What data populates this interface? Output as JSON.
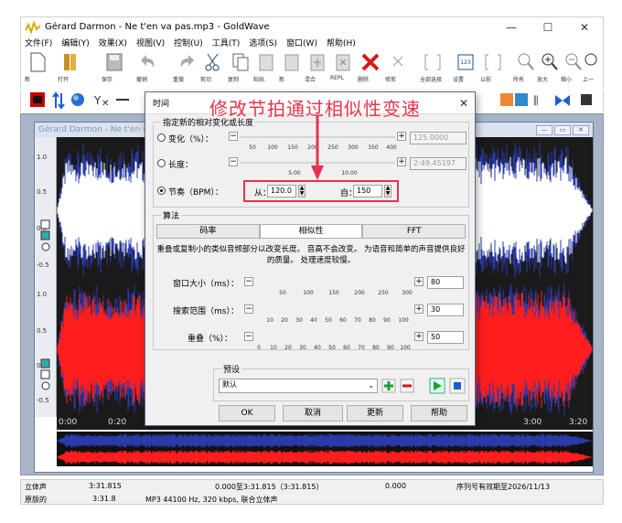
{
  "window": {
    "title": "Gérard Darmon - Ne t'en va pas.mp3 - GoldWave",
    "min": "—",
    "max": "☐",
    "close": "✕"
  },
  "menu": [
    "文件(F)",
    "编辑(Y)",
    "效果(X)",
    "视图(V)",
    "控制(U)",
    "工具(T)",
    "选项(S)",
    "窗口(W)",
    "帮助(H)"
  ],
  "toolbar": [
    {
      "label": "新"
    },
    {
      "label": "打开"
    },
    {
      "label": "保存"
    },
    {
      "label": "撤销"
    },
    {
      "label": "重做"
    },
    {
      "label": "剪切"
    },
    {
      "label": "复制"
    },
    {
      "label": "粘贴"
    },
    {
      "label": "新"
    },
    {
      "label": "混合"
    },
    {
      "label": "REPL"
    },
    {
      "label": "删除"
    },
    {
      "label": "修剪"
    },
    {
      "label": "全部选择"
    },
    {
      "label": "设置"
    },
    {
      "label": "以前"
    },
    {
      "label": "所有"
    },
    {
      "label": "放大"
    },
    {
      "label": "缩小"
    },
    {
      "label": "上一"
    }
  ],
  "doc": {
    "title": "Gérard Darmon - Ne t'en va pas"
  },
  "waveform": {
    "left_labels": [
      "1.0",
      "0.5",
      "0.0",
      "-0.5",
      "1.0",
      "0.5",
      "0.0",
      "-0.5"
    ],
    "timeline": [
      "0:00",
      "0:20",
      "3:00",
      "3:20"
    ],
    "colors": {
      "left": "#ffffff",
      "right": "#ff1e1e",
      "bg": "#1a1a1a",
      "overview_blue": "#2a3aa8"
    }
  },
  "dialog": {
    "title": "时间",
    "annotation": "修改节拍通过相似性变速",
    "group1_label": "指定新的相对变化或长度",
    "change_label": "变化（%）：",
    "change_value": "125.0000",
    "change_ticks": [
      "50",
      "100",
      "150",
      "200",
      "250",
      "300",
      "350",
      "400"
    ],
    "length_label": "长度：",
    "length_value": "2:49.45197",
    "length_ticks": [
      "5:00",
      "10:00"
    ],
    "tempo_label": "节奏（BPM）：",
    "from_label": "从：",
    "from_value": "120.0",
    "to_label": "自：",
    "to_value": "150",
    "algo_label": "算法",
    "tabs": [
      "码率",
      "相似性",
      "FFT"
    ],
    "active_tab": 1,
    "description": "重叠或复制小的类似音频部分以改变长度。 音高不会改变。 为语音和简单的声音提供良好的质量。 处理速度较慢。",
    "window_label": "窗口大小（ms）：",
    "window_value": "80",
    "window_ticks": [
      "50",
      "100",
      "150",
      "200",
      "250",
      "300"
    ],
    "search_label": "搜索范围（ms）：",
    "search_value": "30",
    "search_ticks": [
      "10",
      "20",
      "30",
      "40",
      "50",
      "60",
      "70",
      "80",
      "90",
      "100"
    ],
    "overlap_label": "重叠（%）：",
    "overlap_value": "50",
    "overlap_ticks": [
      "0",
      "10",
      "20",
      "30",
      "40",
      "50",
      "60",
      "70",
      "80",
      "90",
      "100"
    ],
    "preset_label": "预设",
    "preset_value": "默认",
    "buttons": {
      "ok": "OK",
      "cancel": "取消",
      "update": "更新",
      "help": "帮助"
    }
  },
  "status": {
    "row1": [
      "立体声",
      "3:31.815",
      "0.000至3:31.815（3:31.815）",
      "0.000",
      "序列号有效期至2026/11/13"
    ],
    "row2": [
      "原版的",
      "3:31.8",
      "MP3 44100 Hz, 320 kbps, 联合立体声"
    ]
  }
}
